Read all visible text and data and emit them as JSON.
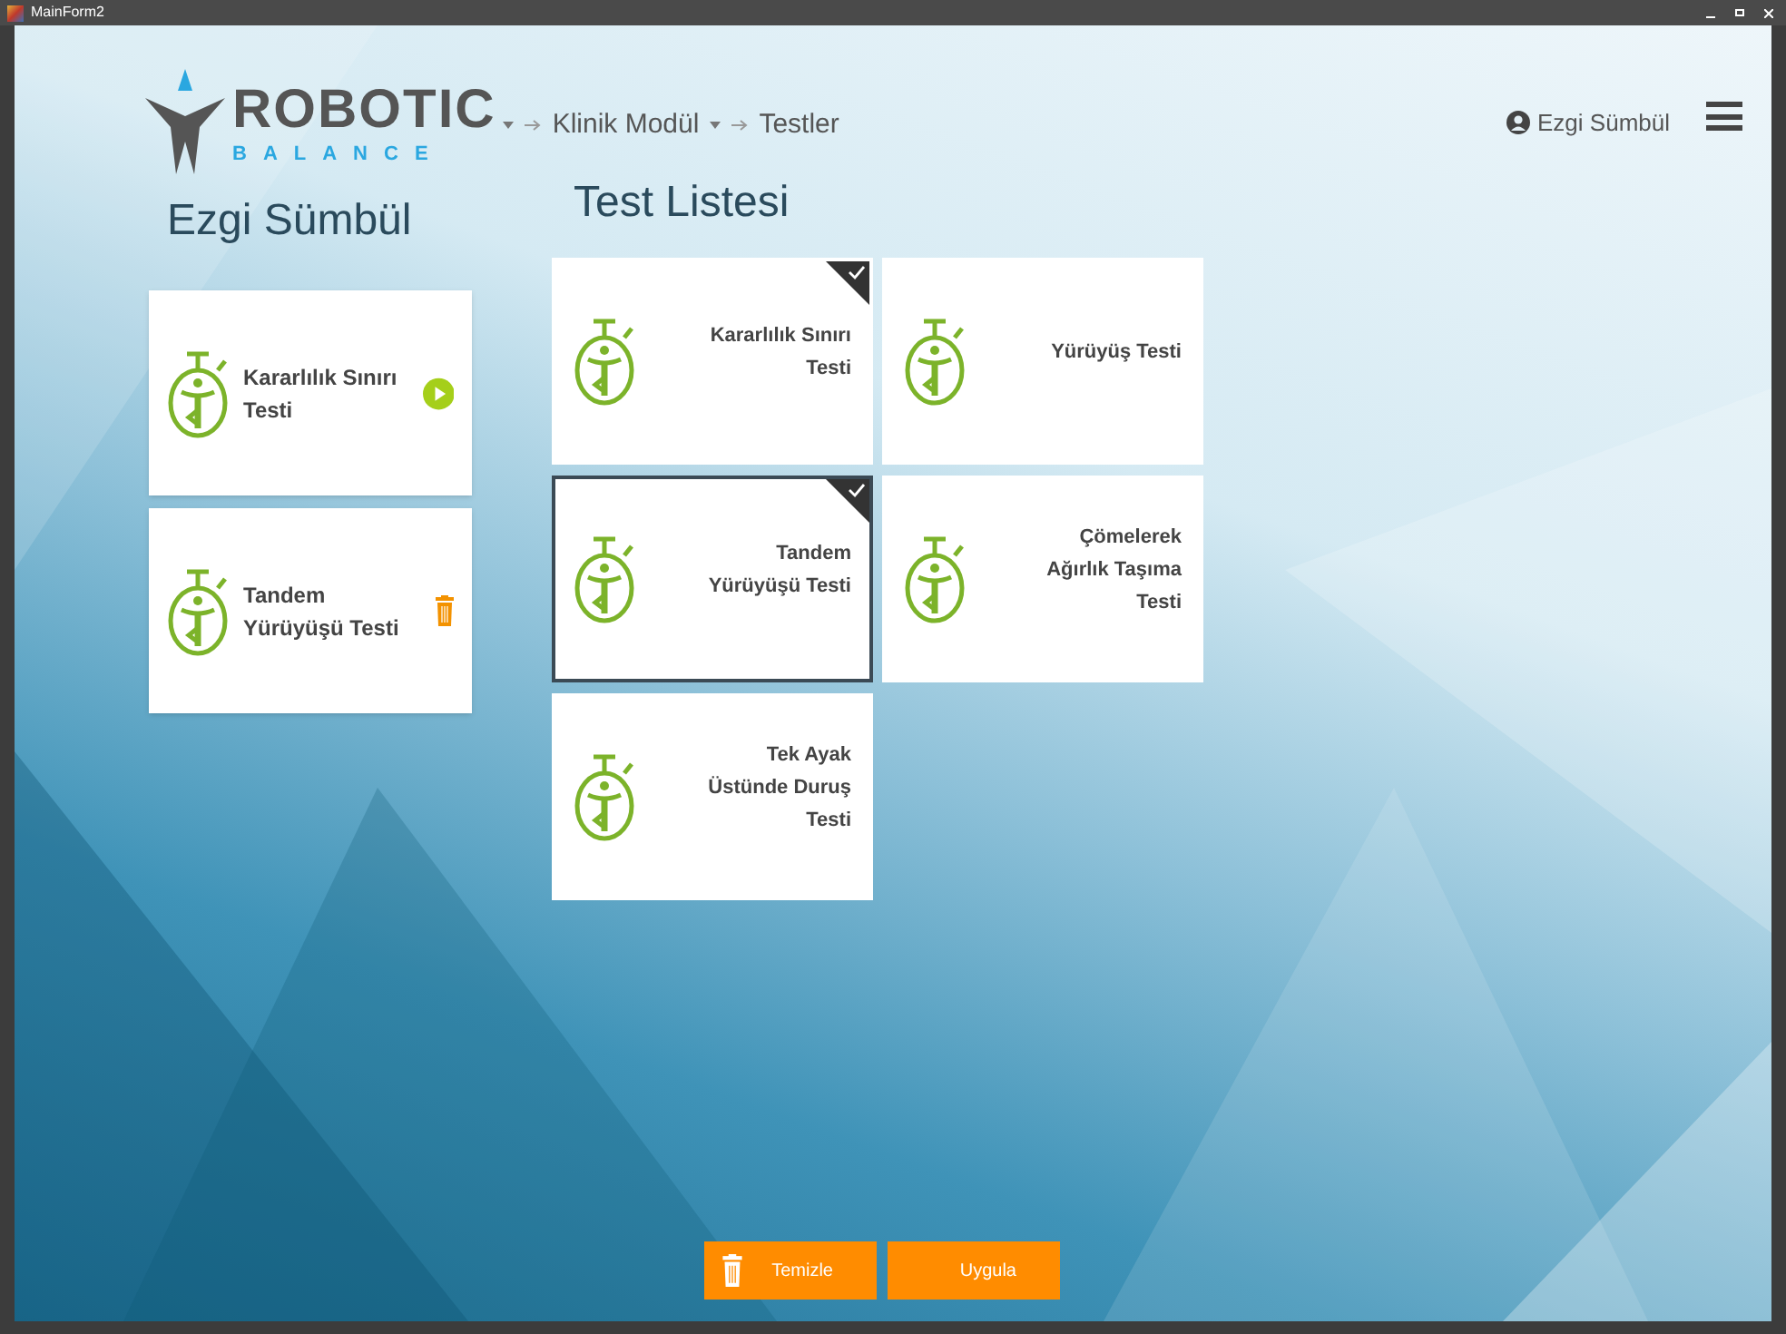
{
  "window": {
    "title": "MainForm2"
  },
  "header": {
    "logo": {
      "word": "ROBOTIC",
      "subword": "BALANCE"
    },
    "breadcrumb": [
      {
        "label": "Klinik Modül",
        "dropdown": true
      },
      {
        "label": "Testler",
        "dropdown": false
      }
    ],
    "user": "Ezgi Sümbül"
  },
  "patient": {
    "title": "Ezgi Sümbül",
    "tests": [
      {
        "label": "Kararlılık Sınırı Testi",
        "kind": "play"
      },
      {
        "label": "Tandem Yürüyüşü Testi",
        "kind": "delete"
      }
    ]
  },
  "test_list": {
    "title": "Test Listesi",
    "items": [
      {
        "label": "Kararlılık Sınırı Testi",
        "checked": true,
        "selected": false
      },
      {
        "label": "Yürüyüş Testi",
        "checked": false,
        "selected": false
      },
      {
        "label": "Tandem Yürüyüşü Testi",
        "checked": true,
        "selected": true
      },
      {
        "label": "Çömelerek Ağırlık Taşıma Testi",
        "checked": false,
        "selected": false
      },
      {
        "label": "Tek Ayak Üstünde Duruş Testi",
        "checked": false,
        "selected": false
      }
    ]
  },
  "buttons": [
    {
      "label": "Temizle",
      "kind": "clear"
    },
    {
      "label": "Uygula",
      "kind": "apply"
    }
  ]
}
